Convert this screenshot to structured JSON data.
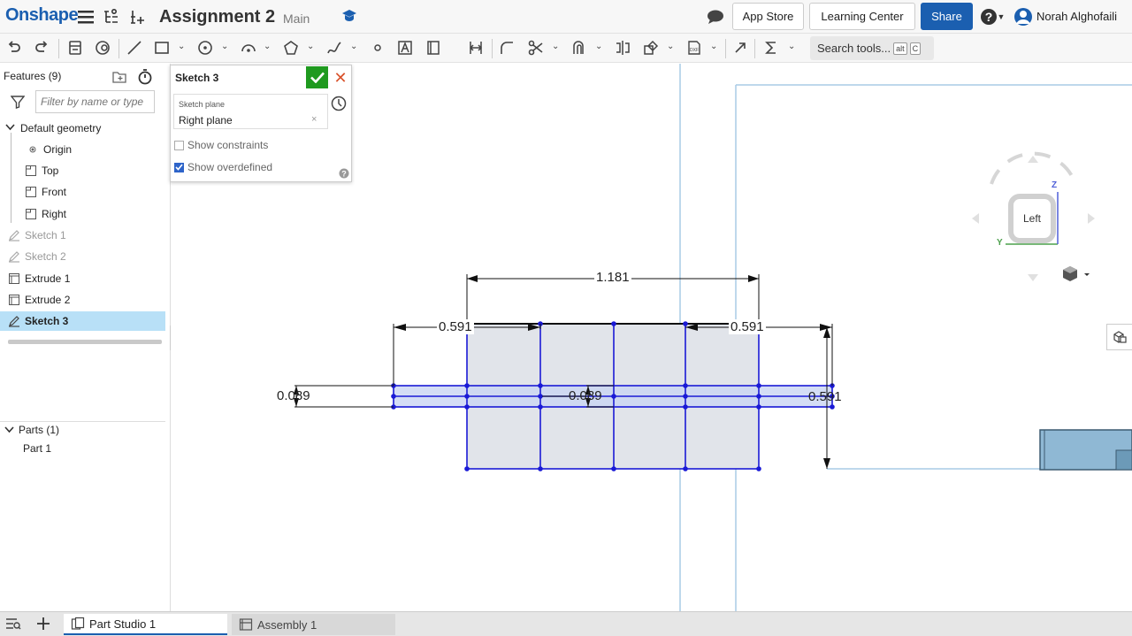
{
  "app": {
    "brand": "Onshape"
  },
  "document": {
    "title": "Assignment 2",
    "branch": "Main"
  },
  "topbar": {
    "app_store": "App Store",
    "learning_center": "Learning Center",
    "share": "Share",
    "user_name": "Norah Alghofaili"
  },
  "toolbar": {
    "search_label": "Search tools...",
    "search_key1": "alt",
    "search_key2": "C"
  },
  "features": {
    "title": "Features (9)",
    "filter_placeholder": "Filter by name or type",
    "items": [
      {
        "label": "Default geometry"
      },
      {
        "label": "Origin"
      },
      {
        "label": "Top"
      },
      {
        "label": "Front"
      },
      {
        "label": "Right"
      },
      {
        "label": "Sketch 1"
      },
      {
        "label": "Sketch 2"
      },
      {
        "label": "Extrude 1"
      },
      {
        "label": "Extrude 2"
      },
      {
        "label": "Sketch 3"
      }
    ]
  },
  "parts": {
    "title": "Parts (1)",
    "items": [
      {
        "label": "Part 1"
      }
    ]
  },
  "sketch_dialog": {
    "title": "Sketch 3",
    "plane_label": "Sketch plane",
    "plane_value": "Right plane",
    "plane_clear": "×",
    "cancel": "✕",
    "show_constraints": "Show constraints",
    "show_overdefined": "Show overdefined",
    "show_constraints_checked": false,
    "show_overdefined_checked": true
  },
  "viewcube": {
    "face": "Left",
    "axis_z": "Z",
    "axis_y": "Y"
  },
  "dimensions": {
    "top_width": "1.181",
    "left_width": "0.591",
    "right_width": "0.591",
    "left_height": "0.089",
    "center_height": "0.089",
    "right_height": "0.591"
  },
  "bottom_tabs": [
    {
      "label": "Part Studio 1",
      "active": true
    },
    {
      "label": "Assembly 1",
      "active": false
    }
  ],
  "colors": {
    "brand": "#1b5fb0",
    "confirm": "#1f9a1f",
    "cancel": "#d9532c",
    "selection": "#b8e0f7",
    "sketch_line": "#1a1ad6",
    "sketch_fill": "#e1e4ea",
    "plane": "#a9cbe6",
    "part": "#8fb8d4"
  }
}
